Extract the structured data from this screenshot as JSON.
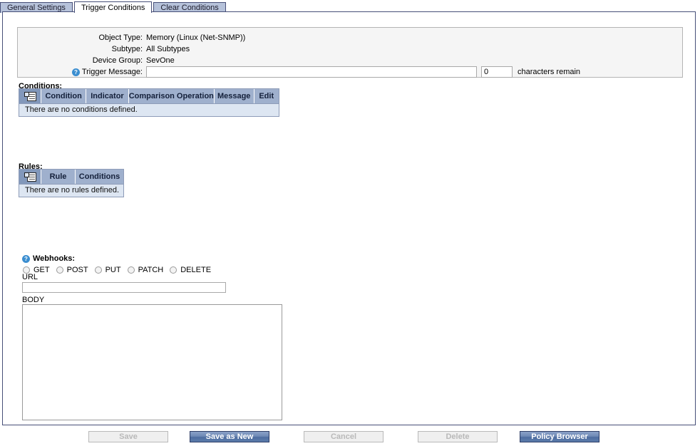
{
  "tabs": [
    {
      "label": "General Settings",
      "active": false
    },
    {
      "label": "Trigger Conditions",
      "active": true
    },
    {
      "label": "Clear Conditions",
      "active": false
    }
  ],
  "info": {
    "object_type_label": "Object Type:",
    "object_type_value": "Memory (Linux (Net-SNMP))",
    "subtype_label": "Subtype:",
    "subtype_value": "All Subtypes",
    "device_group_label": "Device Group:",
    "device_group_value": "SevOne",
    "trigger_message_label": "Trigger Message:",
    "trigger_message_value": "",
    "trigger_message_placeholder": "",
    "help_glyph": "?",
    "characters_count": "0",
    "characters_remain_label": "characters remain"
  },
  "conditions": {
    "title": "Conditions:",
    "columns": [
      "Condition",
      "Indicator",
      "Comparison Operation",
      "Message",
      "Edit"
    ],
    "empty_text": "There are no conditions defined.",
    "rows": []
  },
  "rules": {
    "title": "Rules:",
    "columns": [
      "Rule",
      "Conditions"
    ],
    "empty_text": "There are no rules defined.",
    "rows": []
  },
  "webhooks": {
    "title": "Webhooks:",
    "help_glyph": "?",
    "methods": [
      "GET",
      "POST",
      "PUT",
      "PATCH",
      "DELETE"
    ],
    "selected_method": null,
    "url_label": "URL",
    "url_value": "",
    "body_label": "BODY",
    "body_value": ""
  },
  "footer": {
    "buttons": [
      {
        "label": "Save",
        "enabled": false
      },
      {
        "label": "Save as New",
        "enabled": true
      },
      {
        "label": "Cancel",
        "enabled": false
      },
      {
        "label": "Delete",
        "enabled": false
      },
      {
        "label": "Policy Browser",
        "enabled": true
      }
    ]
  },
  "colors": {
    "tab_inactive": "#b6c2da",
    "panel_border": "#474f78",
    "grid_header": "#9fb0cd",
    "grid_empty_row": "#dde6f2",
    "primary_button": "#4e6da0",
    "help_icon": "#3b8ed0"
  }
}
